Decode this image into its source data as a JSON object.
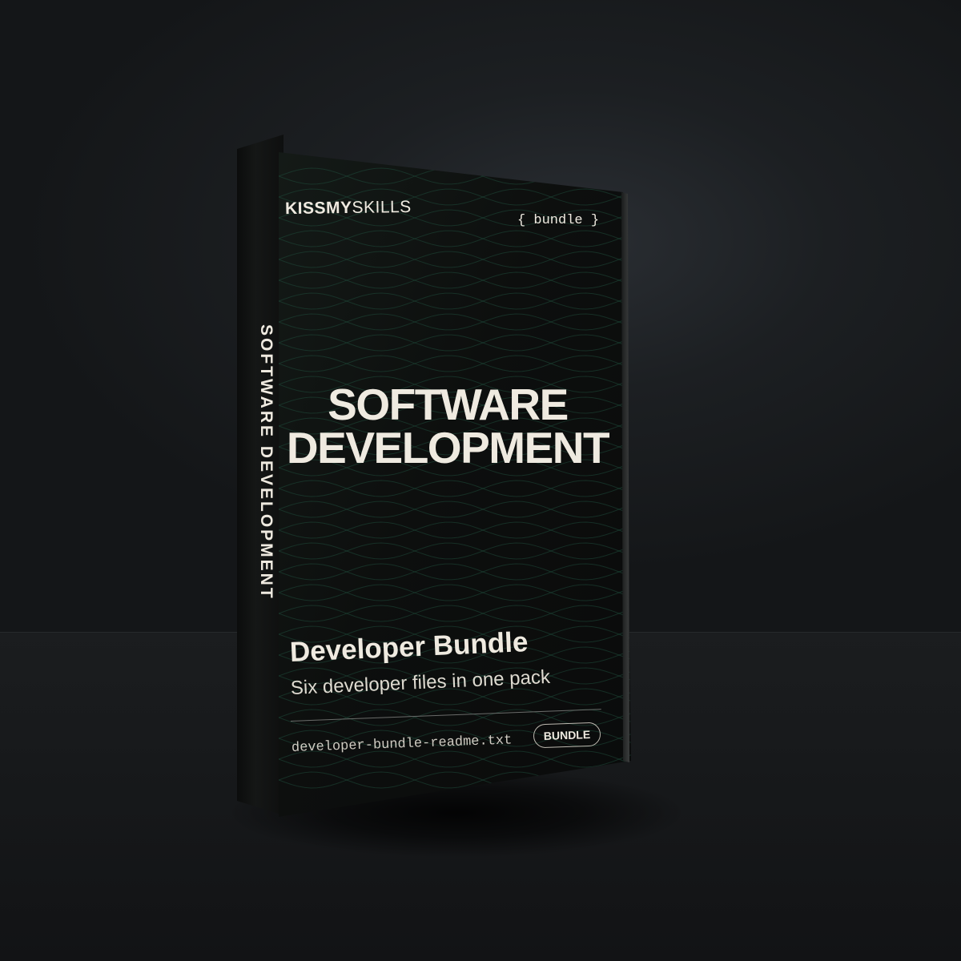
{
  "brand": {
    "bold_part": "KISSMY",
    "light_part": "SKILLS"
  },
  "tag": "{ bundle }",
  "title": {
    "line1": "SOFTWARE",
    "line2": "DEVELOPMENT"
  },
  "spine_text": "SOFTWARE DEVELOPMENT",
  "subtitle": "Developer Bundle",
  "description": "Six developer files in one pack",
  "filename": "developer-bundle-readme.txt",
  "badge": "BUNDLE",
  "colors": {
    "background": "#1c1f22",
    "cover": "#0d0f0e",
    "text": "#efeae0",
    "wave_lines": "#1f4a3a"
  }
}
